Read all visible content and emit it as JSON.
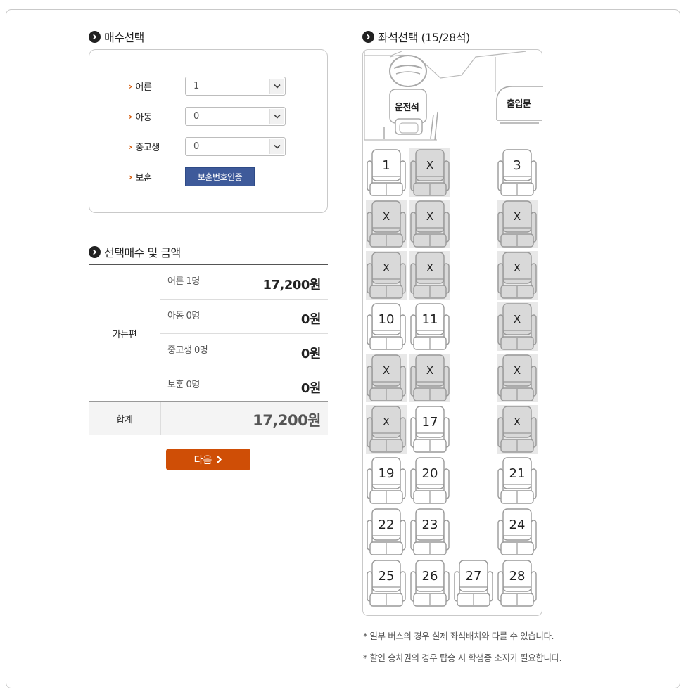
{
  "ticket_count": {
    "title": "매수선택",
    "rows": [
      {
        "label": "어른",
        "value": "1"
      },
      {
        "label": "아동",
        "value": "0"
      },
      {
        "label": "중고생",
        "value": "0"
      }
    ],
    "veteran": {
      "label": "보훈",
      "button": "보훈번호인증"
    }
  },
  "price": {
    "title": "선택매수 및 금액",
    "direction": "가는편",
    "rows": [
      {
        "label": "어른 1명",
        "value": "17,200원"
      },
      {
        "label": "아동 0명",
        "value": "0원"
      },
      {
        "label": "중고생 0명",
        "value": "0원"
      },
      {
        "label": "보훈 0명",
        "value": "0원"
      }
    ],
    "total_label": "합계",
    "total_value": "17,200원"
  },
  "next_button": "다음",
  "seat_map": {
    "title": "좌석선택 (15/28석)",
    "driver_label": "운전석",
    "door_label": "출입문",
    "seats": [
      {
        "num": "1",
        "label": "1",
        "available": true
      },
      {
        "num": "2",
        "label": "X",
        "available": false
      },
      {
        "num": "3",
        "label": "3",
        "available": true
      },
      {
        "num": "4",
        "label": "X",
        "available": false
      },
      {
        "num": "5",
        "label": "X",
        "available": false
      },
      {
        "num": "6",
        "label": "X",
        "available": false
      },
      {
        "num": "7",
        "label": "X",
        "available": false
      },
      {
        "num": "8",
        "label": "X",
        "available": false
      },
      {
        "num": "9",
        "label": "X",
        "available": false
      },
      {
        "num": "10",
        "label": "10",
        "available": true
      },
      {
        "num": "11",
        "label": "11",
        "available": true
      },
      {
        "num": "12",
        "label": "X",
        "available": false
      },
      {
        "num": "13",
        "label": "X",
        "available": false
      },
      {
        "num": "14",
        "label": "X",
        "available": false
      },
      {
        "num": "15",
        "label": "X",
        "available": false
      },
      {
        "num": "16",
        "label": "X",
        "available": false
      },
      {
        "num": "17",
        "label": "17",
        "available": true
      },
      {
        "num": "18",
        "label": "X",
        "available": false
      },
      {
        "num": "19",
        "label": "19",
        "available": true
      },
      {
        "num": "20",
        "label": "20",
        "available": true
      },
      {
        "num": "21",
        "label": "21",
        "available": true
      },
      {
        "num": "22",
        "label": "22",
        "available": true
      },
      {
        "num": "23",
        "label": "23",
        "available": true
      },
      {
        "num": "24",
        "label": "24",
        "available": true
      },
      {
        "num": "25",
        "label": "25",
        "available": true
      },
      {
        "num": "26",
        "label": "26",
        "available": true
      },
      {
        "num": "27",
        "label": "27",
        "available": true
      },
      {
        "num": "28",
        "label": "28",
        "available": true
      }
    ]
  },
  "notes": [
    "* 일부 버스의 경우 실제 좌석배치와 다를 수 있습니다.",
    "* 할인 승차권의 경우 탑승 시 학생증 소지가 필요합니다."
  ],
  "colors": {
    "accent_orange": "#cf4e06",
    "verify_blue": "#3e5a9a",
    "taken_seat": "#d9d9d9"
  }
}
